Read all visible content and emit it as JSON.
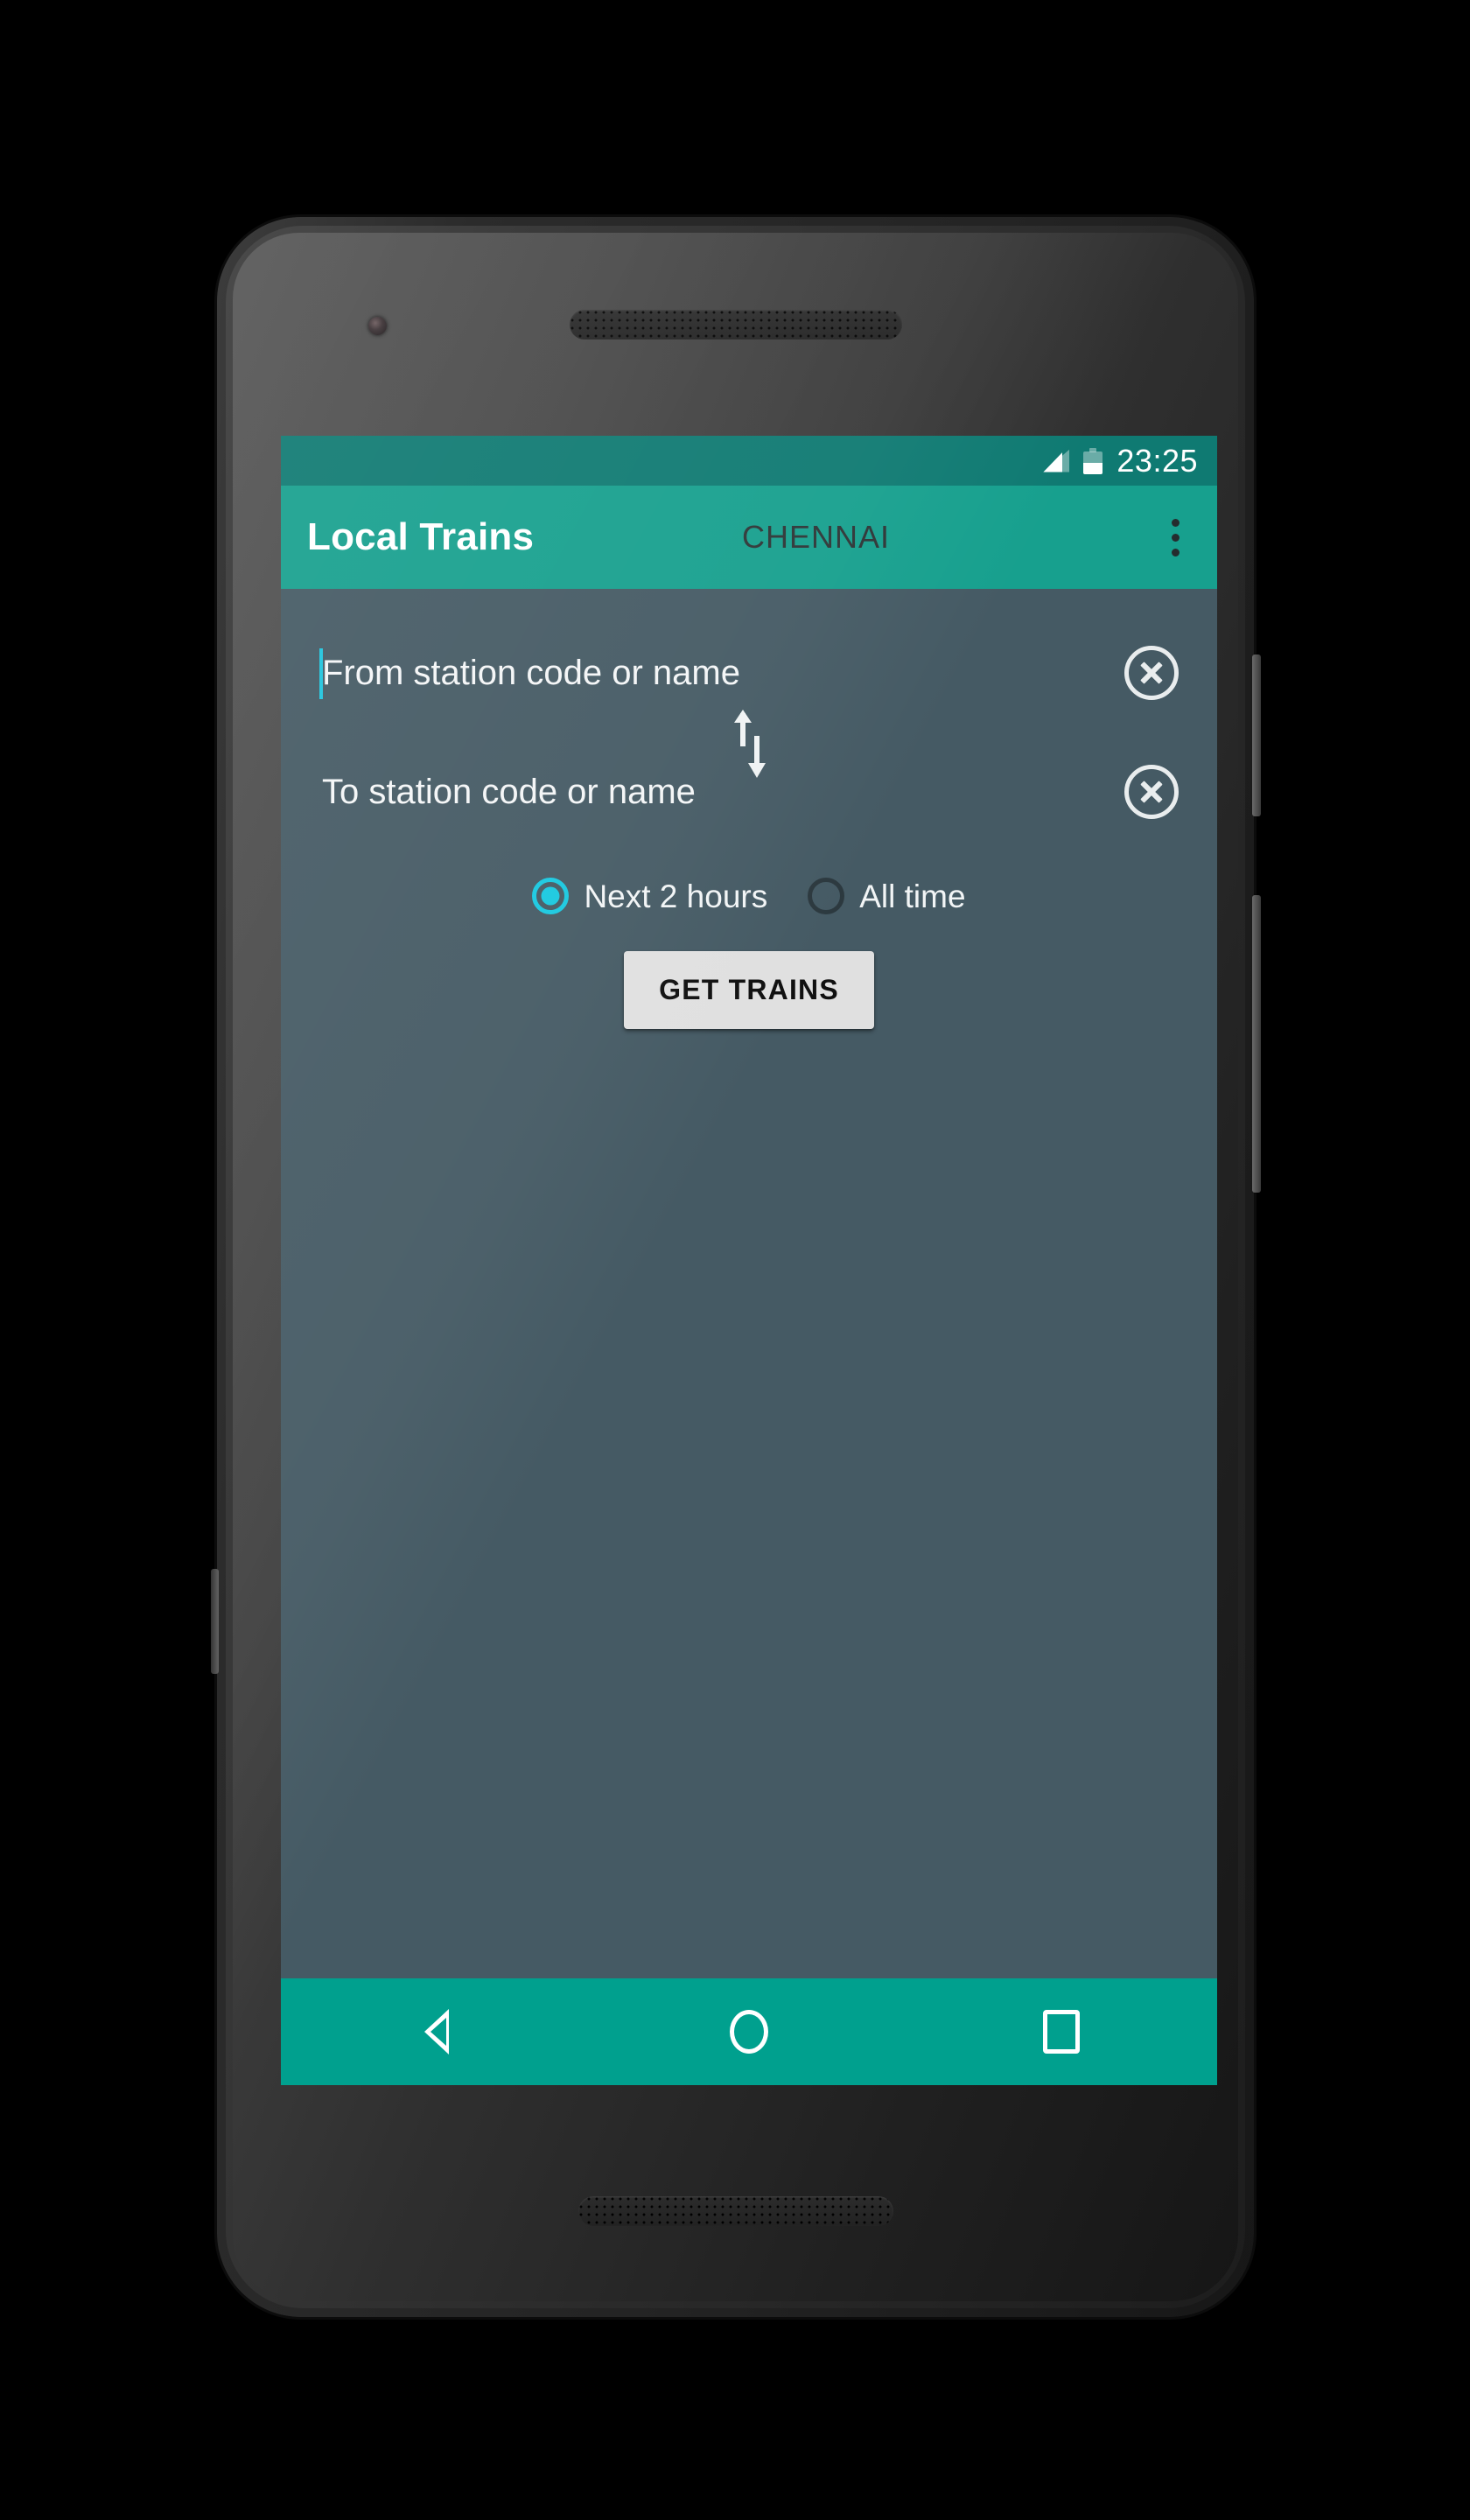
{
  "status_bar": {
    "time": "23:25",
    "signal_icon": "signal-bars-icon",
    "battery_icon": "battery-half-icon"
  },
  "app_bar": {
    "title": "Local Trains",
    "city": "CHENNAI",
    "overflow_icon": "overflow-menu-icon"
  },
  "form": {
    "from_field": {
      "placeholder": "From station code or name",
      "value": "",
      "clear_icon": "clear-circle-icon",
      "focused": true
    },
    "to_field": {
      "placeholder": "To station code or name",
      "value": "",
      "clear_icon": "clear-circle-icon",
      "focused": false
    },
    "swap_icon": "swap-vertical-icon",
    "time_filter": {
      "options": [
        {
          "label": "Next 2 hours",
          "selected": true
        },
        {
          "label": "All time",
          "selected": false
        }
      ]
    },
    "submit_label": "GET TRAINS"
  },
  "nav_bar": {
    "back_icon": "back-triangle-icon",
    "home_icon": "home-circle-icon",
    "recents_icon": "recents-square-icon"
  },
  "colors": {
    "status_bar": "#0f7a72",
    "app_bar": "#17a08e",
    "nav_bar": "#00a08e",
    "content_bg": "#455a64",
    "accent": "#18c8e0",
    "caret": "#1fc4de",
    "button_bg": "#e0e0e0"
  }
}
